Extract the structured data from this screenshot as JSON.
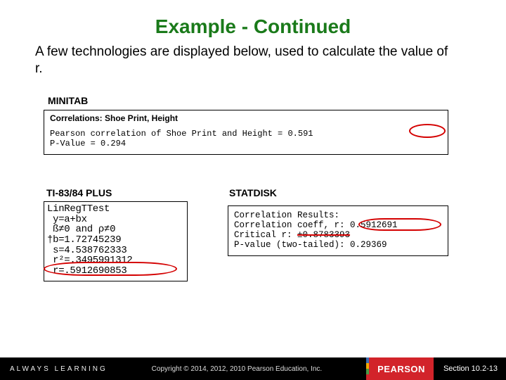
{
  "title": "Example - Continued",
  "intro": "A few technologies are displayed below, used to calculate the value of r.",
  "minitab": {
    "label": "MINITAB",
    "heading": "Correlations: Shoe Print, Height",
    "line1_pre": "Pearson correlation of Shoe Print and Height = ",
    "line1_val": "0.591",
    "line2": "P-Value = 0.294"
  },
  "ti": {
    "label": "TI-83/84 PLUS",
    "lines": "LinRegTTest\n y=a+bx\n ß≠0 and ρ≠0\n†b=1.72745239\n s=4.538762333\n r²=.3495991312\n r=.5912690853"
  },
  "statdisk": {
    "label": "STATDISK",
    "l1": "Correlation Results:",
    "l2a": "Correlation coeff, ",
    "l2b": "r: 0.5912691",
    "l3a": "Critical r: ",
    "l3b": "±0.8783393",
    "l4": "P-value (two-tailed): 0.29369"
  },
  "footer": {
    "always": "ALWAYS LEARNING",
    "copyright": "Copyright © 2014, 2012, 2010 Pearson Education, Inc.",
    "brand": "PEARSON",
    "section": "Section 10.2-13"
  }
}
